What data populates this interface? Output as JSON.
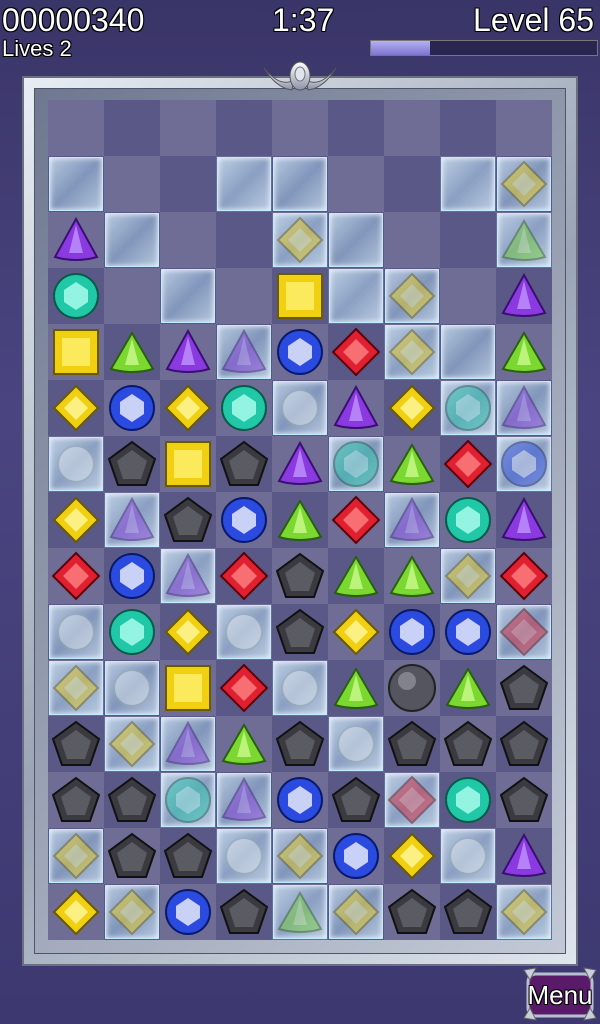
{
  "hud": {
    "score": "00000340",
    "lives_label": "Lives  2",
    "timer": "1:37",
    "level_label": "Level  65",
    "level_progress": 0.26
  },
  "menu_label": "Menu",
  "colors": {
    "red": "#e02030",
    "blue": "#2a4ae0",
    "yellow": "#f0d010",
    "green": "#7ad830",
    "purple": "#8a3ae0",
    "teal": "#20c8a8",
    "black": "#3a3a40",
    "ice": "#cfeeff"
  },
  "legend": {
    "P": "purple-triangle-gem",
    "G": "green-triangle-gem",
    "T": "teal-round-gem",
    "Y": "yellow-diamond-gem",
    "S": "yellow-square-gem",
    "R": "red-diamond-gem",
    "B": "blue-round-gem",
    "K": "black-pentagon-stone",
    "O": "gray-boulder",
    "I_": "ice-empty",
    "I?": "ice-covered-gem",
    ".": "empty-cell",
    "-": "hidden-cell"
  },
  "board": {
    "rows": [
      [
        ".",
        ".",
        ".",
        ".",
        ".",
        ".",
        ".",
        ".",
        "."
      ],
      [
        "I_",
        ".",
        ".",
        "I_",
        "I_",
        ".",
        ".",
        "I_",
        "IY"
      ],
      [
        "P",
        "I_",
        ".",
        ".",
        "IY",
        "I_",
        ".",
        ".",
        "IG"
      ],
      [
        "T",
        ".",
        "I_",
        ".",
        "S",
        "I_",
        "IY",
        ".",
        "P"
      ],
      [
        "S",
        "G",
        "P",
        "IP",
        "B",
        "R",
        "IY",
        "I_",
        "G"
      ],
      [
        "Y",
        "B",
        "Y",
        "T",
        "IW",
        "P",
        "Y",
        "IT",
        "IP"
      ],
      [
        "IW",
        "K",
        "S",
        "K",
        "P",
        "IT",
        "G",
        "R",
        "IB"
      ],
      [
        "Y",
        "IP",
        "K",
        "B",
        "G",
        "R",
        "IP",
        "T",
        "P"
      ],
      [
        "R",
        "B",
        "IP",
        "R",
        "K",
        "G",
        "G",
        "IY",
        "R"
      ],
      [
        "IW",
        "T",
        "Y",
        "IW",
        "K",
        "Y",
        "B",
        "B",
        "IR"
      ],
      [
        "IY",
        "IW",
        "S",
        "R",
        "IW",
        "G",
        "O",
        "G",
        "K"
      ],
      [
        "K",
        "IY",
        "IP",
        "G",
        "K",
        "IW",
        "K",
        "K",
        "K"
      ],
      [
        "K",
        "K",
        "IT",
        "IP",
        "B",
        "K",
        "IR",
        "T",
        "K"
      ],
      [
        "IY",
        "K",
        "K",
        "IW",
        "IY",
        "B",
        "Y",
        "IW",
        "P"
      ],
      [
        "Y",
        "IY",
        "B",
        "K",
        "IG",
        "IY",
        "K",
        "K",
        "IY"
      ]
    ]
  }
}
